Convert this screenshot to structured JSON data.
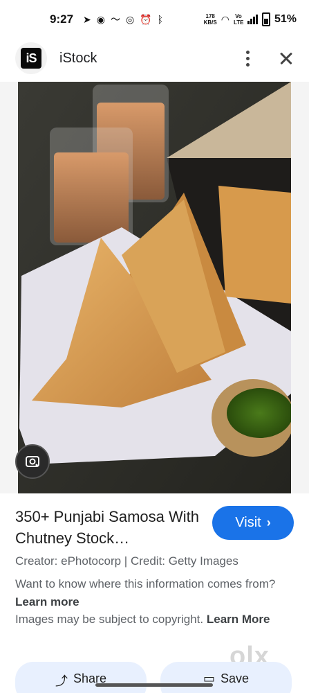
{
  "status_bar": {
    "time": "9:27",
    "net_speed_value": "178",
    "net_speed_unit": "KB/S",
    "volte": "Vo LTE",
    "battery": "51%"
  },
  "header": {
    "logo_text": "iS",
    "site_name": "iStock",
    "icons": [
      "more-vert-icon",
      "close-icon"
    ]
  },
  "image": {
    "lens_icon": "lens-icon"
  },
  "result": {
    "title": "350+ Punjabi Samosa With Chutney Stock…",
    "visit_label": "Visit",
    "credits": "Creator: ePhotocorp | Credit: Getty Images",
    "info_text": "Want to know where this information comes from?",
    "info_link": "Learn more",
    "copyright_text": "Images may be subject to copyright.",
    "copyright_link": "Learn More"
  },
  "watermark": "olx",
  "actions": {
    "share_label": "Share",
    "save_label": "Save"
  },
  "colors": {
    "accent": "#1a73e8",
    "action_bg": "#e8f0fe"
  }
}
